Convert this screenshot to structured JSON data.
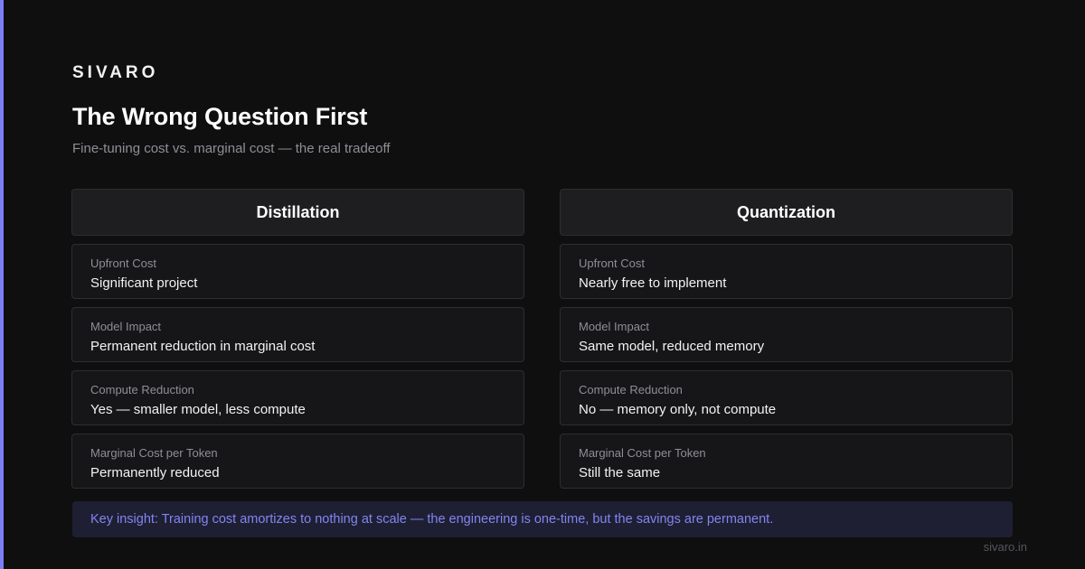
{
  "brand": "SIVARO",
  "title": "The Wrong Question First",
  "subtitle": "Fine-tuning cost vs. marginal cost — the real tradeoff",
  "accent_color": "#7c7ff3",
  "columns": [
    {
      "header": "Distillation",
      "rows": [
        {
          "label": "Upfront Cost",
          "value": "Significant project"
        },
        {
          "label": "Model Impact",
          "value": "Permanent reduction in marginal cost"
        },
        {
          "label": "Compute Reduction",
          "value": "Yes — smaller model, less compute"
        },
        {
          "label": "Marginal Cost per Token",
          "value": "Permanently reduced"
        }
      ]
    },
    {
      "header": "Quantization",
      "rows": [
        {
          "label": "Upfront Cost",
          "value": "Nearly free to implement"
        },
        {
          "label": "Model Impact",
          "value": "Same model, reduced memory"
        },
        {
          "label": "Compute Reduction",
          "value": "No — memory only, not compute"
        },
        {
          "label": "Marginal Cost per Token",
          "value": "Still the same"
        }
      ]
    }
  ],
  "insight": "Key insight: Training cost amortizes to nothing at scale — the engineering is one-time, but the savings are permanent.",
  "footer": "sivaro.in"
}
